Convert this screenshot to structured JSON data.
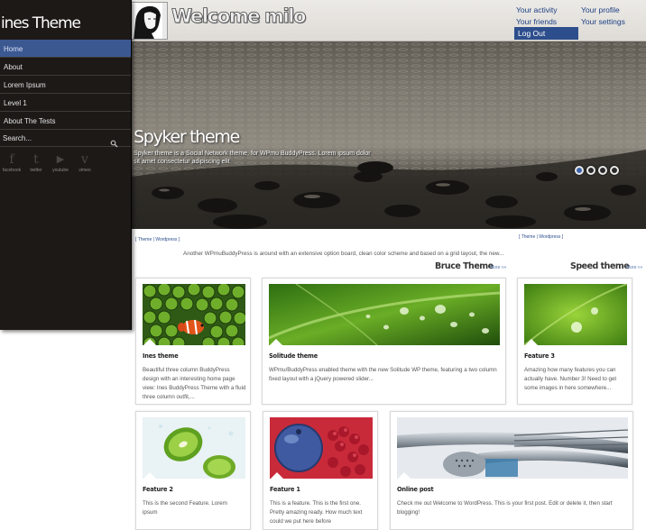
{
  "header": {
    "welcome": "Welcome milo",
    "links": {
      "activity": "Your activity",
      "profile": "Your profile",
      "friends": "Your friends",
      "settings": "Your settings",
      "logout": "Log Out"
    }
  },
  "sidebar": {
    "title": "ines Theme",
    "items": [
      {
        "label": "Home"
      },
      {
        "label": "About"
      },
      {
        "label": "Lorem Ipsum"
      },
      {
        "label": "Level 1"
      },
      {
        "label": "About The Tests"
      }
    ],
    "search_placeholder": "Search...",
    "social": [
      {
        "glyph": "f",
        "label": "facebook",
        "icon": "facebook-icon"
      },
      {
        "glyph": "t",
        "label": "twitter",
        "icon": "twitter-icon"
      },
      {
        "glyph": "▶",
        "label": "youtube",
        "icon": "youtube-icon"
      },
      {
        "glyph": "v",
        "label": "vimeo",
        "icon": "vimeo-icon"
      }
    ]
  },
  "slider": {
    "title": "Spyker theme",
    "description": "Spyker theme is a Social Network theme, for WPmu BuddyPress. Lorem ipsum dolor sit amet consectetur adipiscing elit",
    "dots": 4,
    "active_dot": 0
  },
  "content": {
    "left_tags": "[ Theme | Wordpress ]",
    "right_tags": "[ Theme | Wordpress ]",
    "intro": "Another WPmuBuddyPress is around with an extensive option board, clean color scheme and based on a grid layout,  the new...",
    "section_left": {
      "title": "Bruce Theme",
      "more": "More »»"
    },
    "section_right": {
      "title": "Speed theme",
      "more": "More »»"
    },
    "cards": [
      {
        "title": "Ines theme",
        "text": "Beautiful three column BuddyPress design with an interesting home page view: Ines BuddyPress Theme with a fluid three column outfit,..."
      },
      {
        "title": "Solitude theme",
        "text": "WPmu/BuddyPress enabled theme with the new Solitude WP theme, featuring a two column fixed layout with a jQuery powered slider..."
      },
      {
        "title": "Feature 3",
        "text": "Amazing how many features you can actually have. Number 3! Need to get some images in here somewhere..."
      },
      {
        "title": "Feature 2",
        "text": "This is the second Feature. Lorem ipsum"
      },
      {
        "title": "Feature 1",
        "text": "This is a feature.  This is the first one. Pretty amazing ready.   How much text could we put here before"
      },
      {
        "title": "Online post",
        "text": "Check me out Welcome to WordPress. This is your first post. Edit or delete it, then start blogging!"
      }
    ]
  },
  "colors": {
    "sidebar_bg": "#1c1917",
    "nav_active": "#3c5891",
    "link_blue": "#1c3f84",
    "logout_bg": "#2d4e8c"
  }
}
